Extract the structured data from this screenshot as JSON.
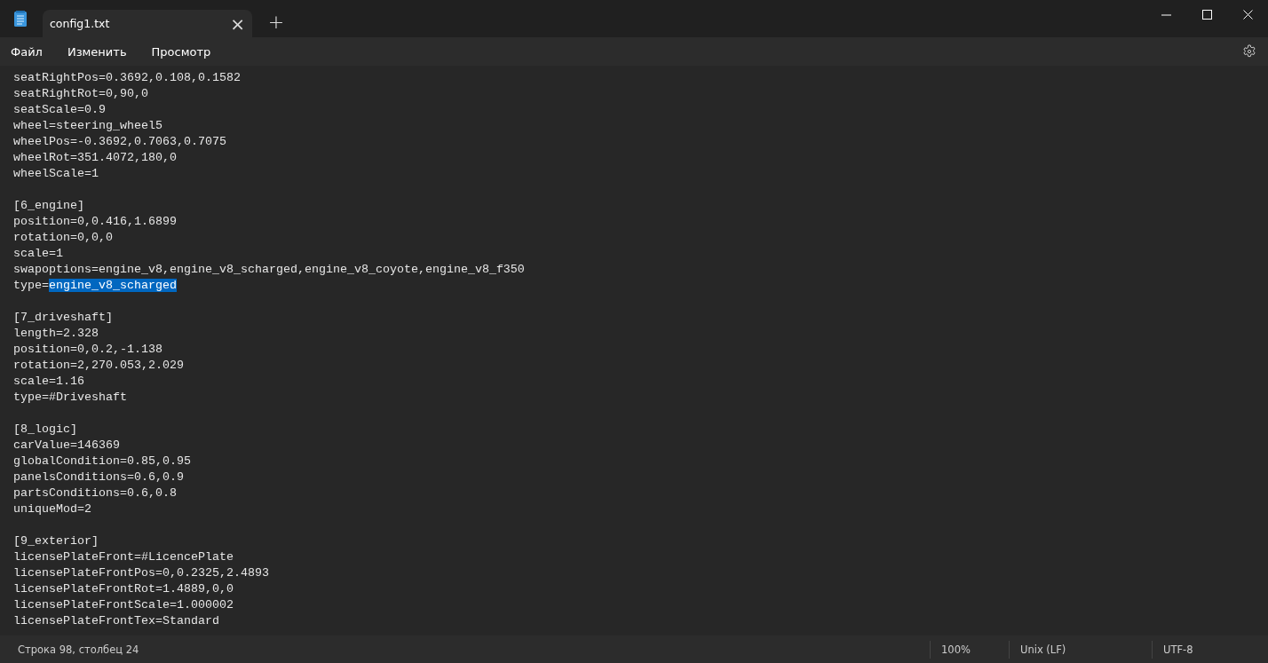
{
  "window": {
    "tabs": [
      {
        "label": "config1.txt",
        "selected": true,
        "close": "×"
      }
    ],
    "new_tab": "+"
  },
  "menu": [
    "Файл",
    "Изменить",
    "Просмотр"
  ],
  "editor": {
    "lines": [
      {
        "kind": "text",
        "text": "seatRightPos=0.3692,0.108,0.1582"
      },
      {
        "kind": "text",
        "text": "seatRightRot=0,90,0"
      },
      {
        "kind": "text",
        "text": "seatScale=0.9"
      },
      {
        "kind": "text",
        "text": "wheel=steering_wheel5"
      },
      {
        "kind": "text",
        "text": "wheelPos=-0.3692,0.7063,0.7075"
      },
      {
        "kind": "text",
        "text": "wheelRot=351.4072,180,0"
      },
      {
        "kind": "text",
        "text": "wheelScale=1"
      },
      {
        "kind": "blank"
      },
      {
        "kind": "text",
        "text": "[6_engine]"
      },
      {
        "kind": "text",
        "text": "position=0,0.416,1.6899"
      },
      {
        "kind": "text",
        "text": "rotation=0,0,0"
      },
      {
        "kind": "text",
        "text": "scale=1"
      },
      {
        "kind": "text",
        "text": "swapoptions=engine_v8,engine_v8_scharged,engine_v8_coyote,engine_v8_f350"
      },
      {
        "kind": "text",
        "text": "type=",
        "selection": "engine_v8_scharged"
      },
      {
        "kind": "blank"
      },
      {
        "kind": "text",
        "text": "[7_driveshaft]"
      },
      {
        "kind": "text",
        "text": "length=2.328"
      },
      {
        "kind": "text",
        "text": "position=0,0.2,-1.138"
      },
      {
        "kind": "text",
        "text": "rotation=2,270.053,2.029"
      },
      {
        "kind": "text",
        "text": "scale=1.16"
      },
      {
        "kind": "text",
        "text": "type=#Driveshaft"
      },
      {
        "kind": "blank"
      },
      {
        "kind": "text",
        "text": "[8_logic]"
      },
      {
        "kind": "text",
        "text": "carValue=146369"
      },
      {
        "kind": "text",
        "text": "globalCondition=0.85,0.95"
      },
      {
        "kind": "text",
        "text": "panelsConditions=0.6,0.9"
      },
      {
        "kind": "text",
        "text": "partsConditions=0.6,0.8"
      },
      {
        "kind": "text",
        "text": "uniqueMod=2"
      },
      {
        "kind": "blank"
      },
      {
        "kind": "text",
        "text": "[9_exterior]"
      },
      {
        "kind": "text",
        "text": "licensePlateFront=#LicencePlate"
      },
      {
        "kind": "text",
        "text": "licensePlateFrontPos=0,0.2325,2.4893"
      },
      {
        "kind": "text",
        "text": "licensePlateFrontRot=1.4889,0,0"
      },
      {
        "kind": "text",
        "text": "licensePlateFrontScale=1.000002"
      },
      {
        "kind": "text",
        "text": "licensePlateFrontTex=Standard"
      }
    ]
  },
  "status_bar": {
    "position": "Строка 98, столбец 24",
    "zoom": "100%",
    "line_endings": "Unix (LF)",
    "encoding": "UTF-8"
  }
}
